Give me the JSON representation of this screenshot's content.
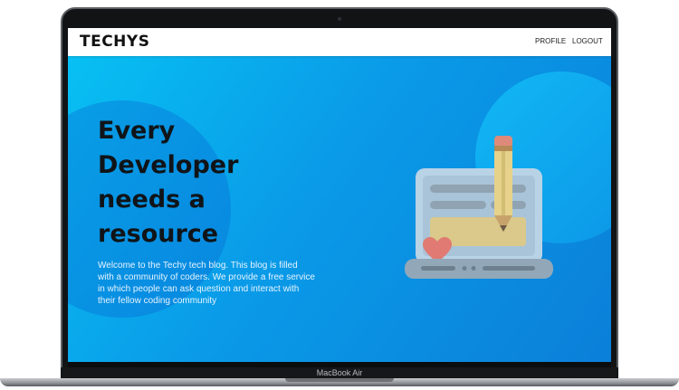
{
  "brand": {
    "name": "TECHYS"
  },
  "nav": {
    "profile_label": "PROFILE",
    "logout_label": "LOGOUT"
  },
  "hero": {
    "title_lines": [
      "Every",
      "Developer",
      "needs a",
      "resource"
    ],
    "description": "Welcome to the Techy tech blog. This blog is filled with a community of coders. We provide a free service in which people can ask question and interact with their fellow coding community"
  },
  "device": {
    "model_label": "MacBook Air"
  },
  "icons": [
    "laptop-pencil-heart-illustration"
  ],
  "colors": {
    "background_start": "#07c2f3",
    "background_end": "#0b7fd9",
    "navbar": "#ffffff",
    "title_text": "#101418",
    "body_text": "#e6f4ff"
  }
}
